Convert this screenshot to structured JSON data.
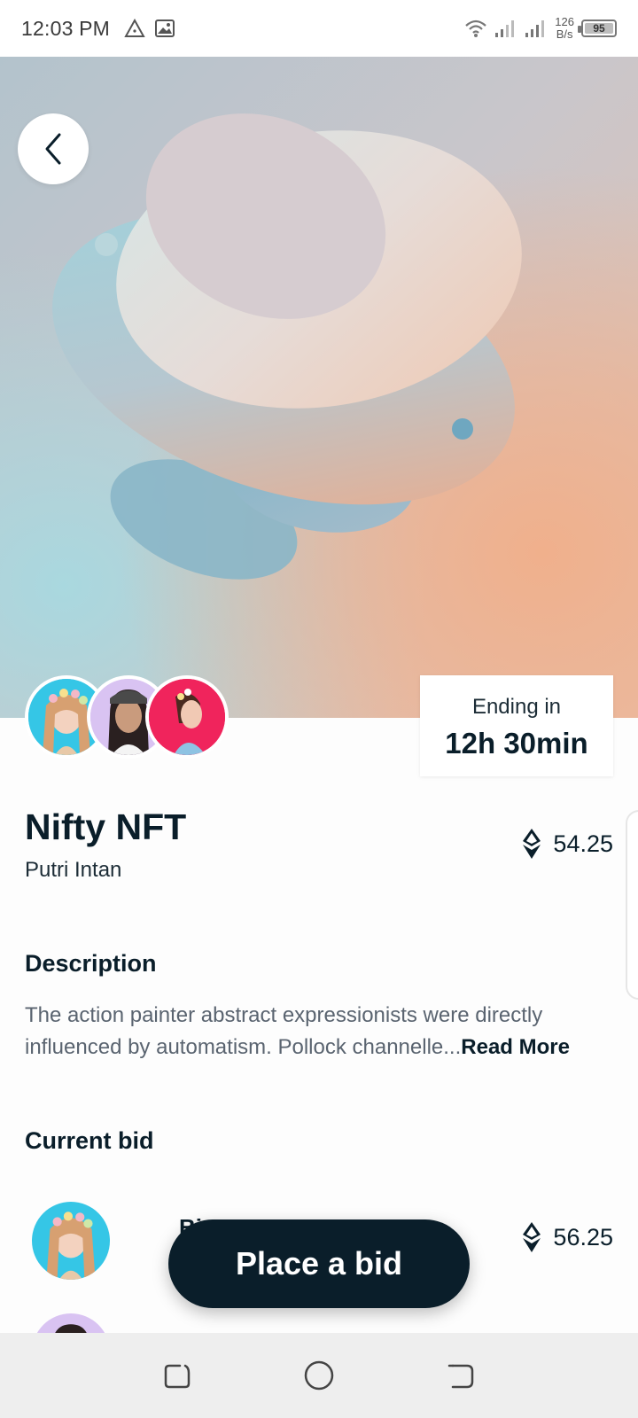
{
  "status_bar": {
    "time": "12:03 PM",
    "net_speed_value": "126",
    "net_speed_unit": "B/s",
    "battery_level": "95",
    "icons": [
      "warning-triangle-icon",
      "image-icon",
      "wifi-icon",
      "signal-icon",
      "signal-icon-2",
      "battery-icon"
    ]
  },
  "hero": {
    "back_icon": "chevron-left-icon"
  },
  "ending": {
    "label": "Ending in",
    "time": "12h 30min"
  },
  "item": {
    "title": "Nifty NFT",
    "creator": "Putri Intan",
    "price": "54.25",
    "currency_icon": "ethereum-icon"
  },
  "description": {
    "heading": "Description",
    "text": "The action painter abstract expressionists were directly influenced by automatism. Pollock channelle...",
    "read_more": "Read More"
  },
  "current_bid": {
    "heading": "Current bid",
    "bids": [
      {
        "name": "Bi",
        "price": "56.25"
      }
    ]
  },
  "cta": {
    "label": "Place a bid"
  },
  "nav": {
    "icons": [
      "recent-apps-icon",
      "home-icon",
      "back-icon"
    ]
  },
  "colors": {
    "primary": "#0a1e2a",
    "text_muted": "#5a6470",
    "avatar_cyan": "#35c6e6",
    "avatar_lavender": "#d9c3f2",
    "avatar_pink": "#f0245c"
  }
}
